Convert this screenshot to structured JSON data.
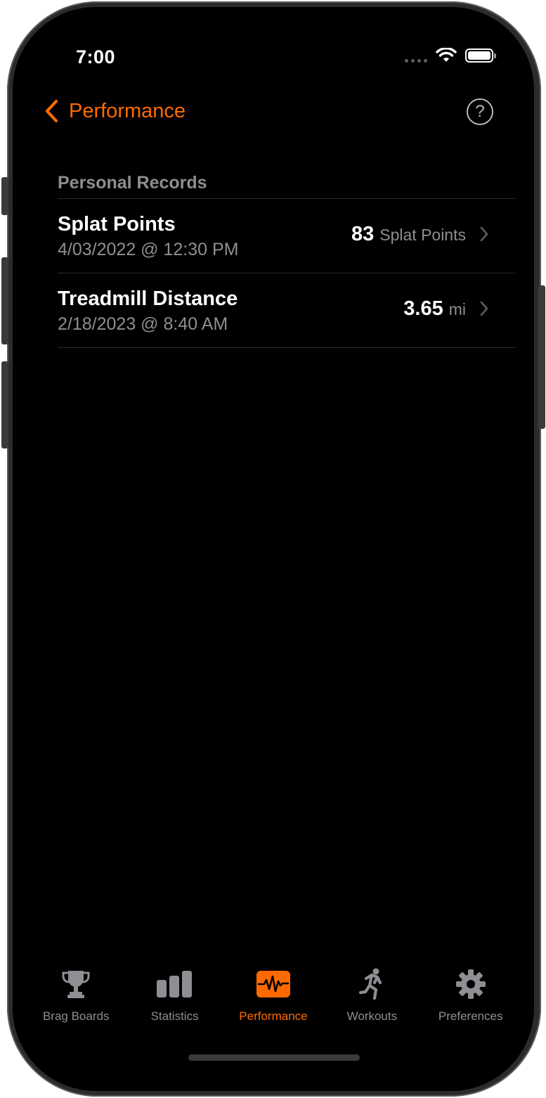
{
  "status_bar": {
    "time": "7:00"
  },
  "nav": {
    "back_label": "Performance",
    "help_symbol": "?"
  },
  "section": {
    "header": "Personal Records"
  },
  "records": [
    {
      "title": "Splat Points",
      "date": "4/03/2022 @ 12:30 PM",
      "value": "83",
      "unit": "Splat Points"
    },
    {
      "title": "Treadmill Distance",
      "date": "2/18/2023 @ 8:40 AM",
      "value": "3.65",
      "unit": "mi"
    }
  ],
  "tabs": [
    {
      "label": "Brag Boards",
      "icon": "trophy-icon",
      "active": false
    },
    {
      "label": "Statistics",
      "icon": "bar-chart-icon",
      "active": false
    },
    {
      "label": "Performance",
      "icon": "waveform-icon",
      "active": true
    },
    {
      "label": "Workouts",
      "icon": "runner-icon",
      "active": false
    },
    {
      "label": "Preferences",
      "icon": "gear-icon",
      "active": false
    }
  ],
  "colors": {
    "accent": "#ff6a00",
    "background": "#000000",
    "secondary_text": "#8e8e93",
    "separator": "#2a2a2c"
  }
}
